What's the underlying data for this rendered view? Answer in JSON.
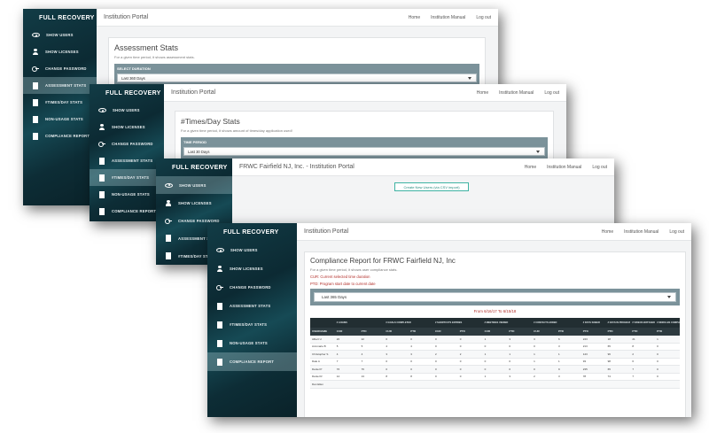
{
  "brand": "FULL RECOVERY",
  "nav_links": {
    "home": "Home",
    "manual": "Institution Manual",
    "logout": "Log out"
  },
  "sidebar_items": [
    {
      "label": "SHOW USERS",
      "icon": "eye-icon"
    },
    {
      "label": "SHOW LICENSES",
      "icon": "user-icon"
    },
    {
      "label": "CHANGE PASSWORD",
      "icon": "key-icon"
    },
    {
      "label": "ASSESSMENT STATS",
      "icon": "document-icon"
    },
    {
      "label": "#TIMES/DAY STATS",
      "icon": "document-icon"
    },
    {
      "label": "NON-USAGE STATS",
      "icon": "document-icon"
    },
    {
      "label": "COMPLIANCE REPORT",
      "icon": "document-icon"
    }
  ],
  "win1": {
    "title": "Institution Portal",
    "card_title": "Assessment Stats",
    "card_sub": "For a given time period, it shows assessment stats.",
    "panel_label": "SELECT DURATION",
    "select_value": "Last 360 Days"
  },
  "win2": {
    "title": "Institution Portal",
    "card_title": "#Times/Day Stats",
    "card_sub": "For a given time period, it shows amount of times/day application used!",
    "panel_label": "TIME PERIOD",
    "select_value": "Last 30 Days"
  },
  "win3": {
    "title": "FRWC Fairfield NJ, Inc. - Institution Portal",
    "button_label": "Create New Users (via CSV import)"
  },
  "win4": {
    "title": "Institution Portal",
    "card_title": "Compliance Report for FRWC Fairfield NJ, Inc",
    "card_sub": "For a given time period, it shows user compliance stats.",
    "note_cur": "CUR: Current selected time duration",
    "note_ptd": "PTD: Program start date to current date",
    "select_value": "Last 365 Days",
    "date_range": "From 6/16/17 To 6/15/18",
    "group_headers": [
      "# LOGINS",
      "# GOALS COMPLETED",
      "# SHORTCUTS ENTRIES",
      "# MEETINGS VIEWED",
      "# CONTACTS ADDED",
      "# DAYS SOBER",
      "# DAYS IN PROGRAM",
      "# VIDEOS WATCHED",
      "# MODULES COMPLETED"
    ],
    "sub_headers": [
      "USERNAME",
      "CUR",
      "PTD",
      "CUR",
      "PTD",
      "CUR",
      "PTD",
      "CUR",
      "PTD",
      "CUR",
      "PTD",
      "PTD",
      "PTD",
      "PTD",
      "PTD"
    ],
    "rows": [
      [
        "Albert U",
        "20",
        "22",
        "0",
        "0",
        "0",
        "0",
        "1",
        "3",
        "3",
        "6",
        "243",
        "18",
        "21",
        "1"
      ],
      [
        "Annmarie B",
        "5",
        "5",
        "4",
        "4",
        "0",
        "0",
        "0",
        "0",
        "0",
        "3",
        "213",
        "65",
        "8",
        "0"
      ],
      [
        "Christopher S",
        "4",
        "4",
        "3",
        "3",
        "2",
        "2",
        "1",
        "1",
        "1",
        "1",
        "143",
        "96",
        "2",
        "0"
      ],
      [
        "Dale A",
        "7",
        "7",
        "0",
        "0",
        "0",
        "0",
        "0",
        "0",
        "1",
        "1",
        "93",
        "98",
        "6",
        "0"
      ],
      [
        "Daniel P",
        "76",
        "76",
        "0",
        "0",
        "0",
        "0",
        "0",
        "0",
        "0",
        "9",
        "235",
        "65",
        "7",
        "0"
      ],
      [
        "Daniel R",
        "12",
        "13",
        "8",
        "8",
        "0",
        "0",
        "1",
        "3",
        "2",
        "3",
        "78",
        "74",
        "7",
        "0"
      ],
      [
        "Dan Ellen",
        "",
        "",
        "",
        "",
        "",
        "",
        "",
        "",
        "",
        "",
        "",
        "",
        "",
        ""
      ]
    ]
  }
}
